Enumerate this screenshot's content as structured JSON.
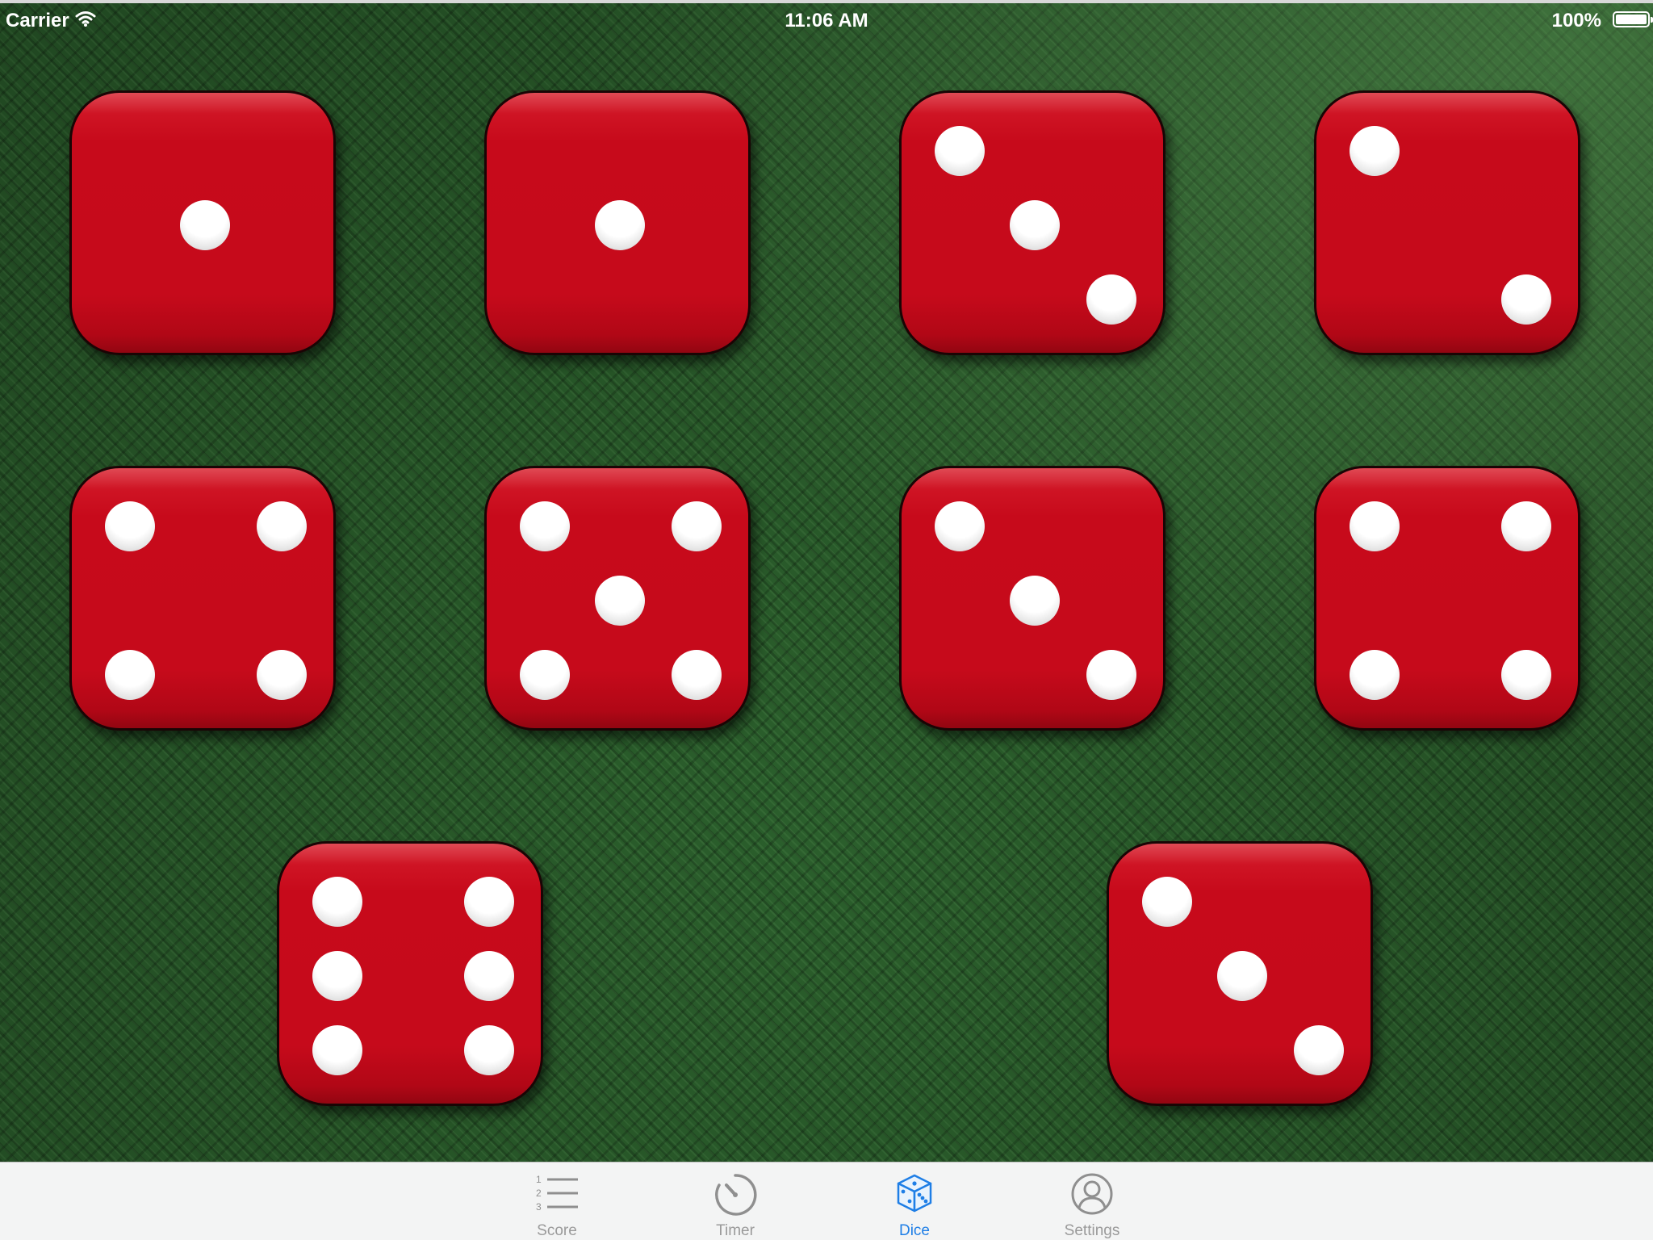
{
  "status_bar": {
    "carrier": "Carrier",
    "time": "11:06 AM",
    "battery": "100%"
  },
  "dice": {
    "values": [
      1,
      1,
      3,
      2,
      4,
      5,
      3,
      4,
      6,
      3
    ],
    "face_color": "#c60a1b",
    "pip_color": "#ffffff"
  },
  "tab_bar": {
    "tabs": [
      {
        "label": "Score",
        "icon": "numbered-list-icon"
      },
      {
        "label": "Timer",
        "icon": "stopwatch-icon"
      },
      {
        "label": "Dice",
        "icon": "dice-icon"
      },
      {
        "label": "Settings",
        "icon": "user-icon"
      }
    ],
    "selected": "Dice",
    "active_color": "#1e7ee6",
    "inactive_color": "#9a9a9a"
  },
  "background": {
    "felt_color": "#2b5f2c"
  }
}
